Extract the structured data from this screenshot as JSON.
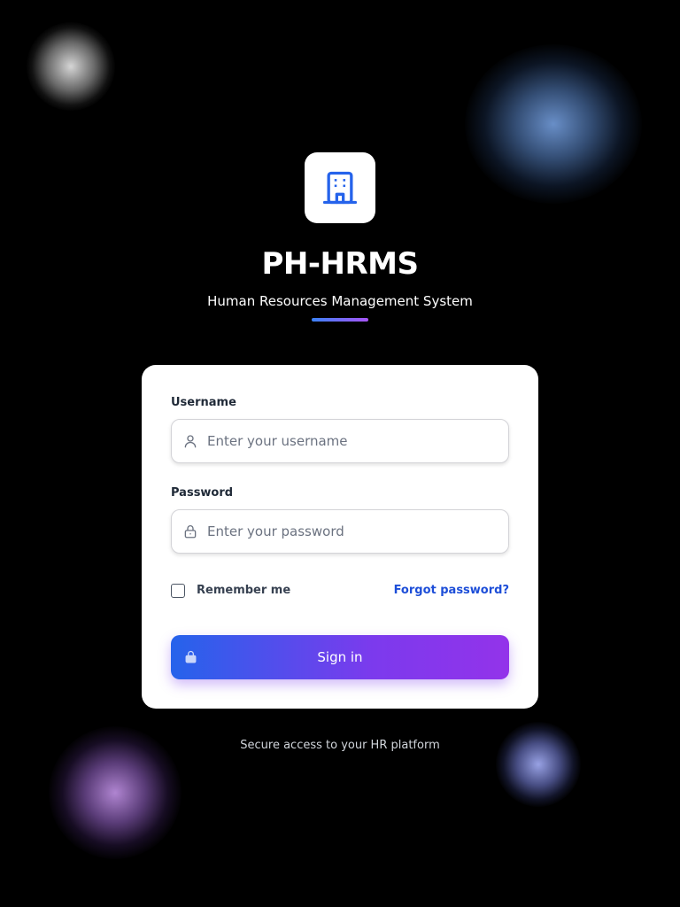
{
  "app": {
    "title": "PH-HRMS",
    "subtitle": "Human Resources Management System"
  },
  "logo": {
    "icon": "building-icon",
    "color": "#2563eb"
  },
  "form": {
    "username": {
      "label": "Username",
      "placeholder": "Enter your username",
      "value": "",
      "icon": "user-icon"
    },
    "password": {
      "label": "Password",
      "placeholder": "Enter your password",
      "value": "",
      "icon": "lock-icon"
    },
    "remember": {
      "label": "Remember me",
      "checked": false
    },
    "forgot_label": "Forgot password?",
    "submit": {
      "label": "Sign in",
      "icon": "lock-icon"
    }
  },
  "footer": {
    "text": "Secure access to your HR platform"
  },
  "colors": {
    "background": "#000000",
    "card": "#ffffff",
    "accent_blue": "#2563eb",
    "accent_purple": "#9333ea",
    "link": "#1d4ed8"
  }
}
